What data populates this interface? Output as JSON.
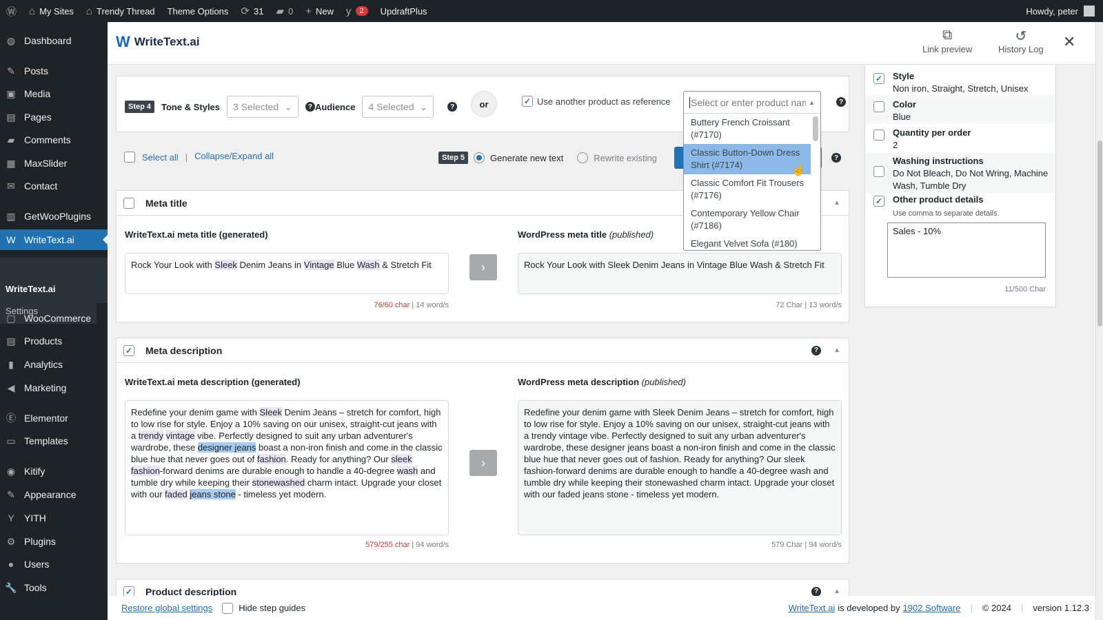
{
  "adminbar": {
    "items": [
      {
        "icon": "wordpress-icon",
        "label": ""
      },
      {
        "icon": "my-sites-icon",
        "label": "My Sites"
      },
      {
        "icon": "home-icon",
        "label": "Trendy Thread"
      },
      {
        "icon": "",
        "label": "Theme Options"
      },
      {
        "icon": "updates-icon",
        "label": "31"
      },
      {
        "icon": "comments-icon",
        "label": "0"
      },
      {
        "icon": "plus-icon",
        "label": "New"
      },
      {
        "icon": "yoast-icon",
        "label": "",
        "badge": "2"
      },
      {
        "icon": "",
        "label": "UpdraftPlus"
      }
    ],
    "howdy": "Howdy, peter"
  },
  "sidebar": {
    "items": [
      "Dashboard",
      "Posts",
      "Media",
      "Pages",
      "Comments",
      "MaxSlider",
      "Contact",
      "GetWooPlugins",
      "WriteText.ai",
      "WooCommerce",
      "Products",
      "Analytics",
      "Marketing",
      "Elementor",
      "Templates",
      "Kitify",
      "Appearance",
      "YITH",
      "Plugins",
      "Users",
      "Tools"
    ],
    "active": "WriteText.ai",
    "submenu": [
      "WriteText.ai",
      "Settings"
    ]
  },
  "header": {
    "brand": "WriteText.ai",
    "link_preview": "Link preview",
    "history_log": "History Log"
  },
  "step4": {
    "badge": "Step 4",
    "tone_label": "Tone & Styles",
    "tone_value": "3 Selected",
    "audience_label": "Audience",
    "audience_value": "4 Selected",
    "or": "or",
    "reference_label": "Use another product as reference",
    "reference_checked": true,
    "product_placeholder": "Select or enter product nam",
    "options": [
      "Buttery French Croissant (#7170)",
      "Classic Button-Down Dress Shirt (#7174)",
      "Classic Comfort Fit Trousers (#7176)",
      "Contemporary Yellow Chair (#7186)",
      "Elegant Velvet Sofa (#180)"
    ],
    "highlighted_option": 1
  },
  "toolbar": {
    "select_all": "Select all",
    "collapse": "Collapse/Expand all",
    "step5": "Step 5",
    "generate": "Generate new text",
    "rewrite": "Rewrite existing",
    "mode": "generate"
  },
  "meta_title": {
    "title": "Meta title",
    "checked": false,
    "gen_label": "WriteText.ai meta title (generated)",
    "pub_label": "WordPress meta title",
    "pub_suffix": "(published)",
    "generated": [
      {
        "t": "Rock Your Look with "
      },
      {
        "t": "Sleek",
        "h": "kw"
      },
      {
        "t": " Denim Jeans in "
      },
      {
        "t": "Vintage",
        "h": "kw"
      },
      {
        "t": " Blue "
      },
      {
        "t": "Wash",
        "h": "kw"
      },
      {
        "t": " & Stretch Fit"
      }
    ],
    "gen_chars": "76/60 char",
    "gen_words": "| 14 word/s",
    "published": "Rock Your Look with Sleek Denim Jeans in Vintage Blue Wash & Stretch Fit",
    "pub_count": "72 Char | 13 word/s"
  },
  "meta_description": {
    "title": "Meta description",
    "checked": true,
    "gen_label": "WriteText.ai meta description (generated)",
    "pub_label": "WordPress meta description",
    "pub_suffix": "(published)",
    "generated": [
      {
        "t": "Redefine your denim game with "
      },
      {
        "t": "Sleek",
        "h": "kw"
      },
      {
        "t": " Denim Jeans – stretch for comfort, high to low rise for style. Enjoy a 10% saving on our unisex, straight-cut jeans with a "
      },
      {
        "t": "trendy",
        "h": "kw"
      },
      {
        "t": " "
      },
      {
        "t": "vintage",
        "h": "kw"
      },
      {
        "t": " vibe. Perfectly designed to suit any urban adventurer's wardrobe, these "
      },
      {
        "t": "designer jeans",
        "h": "hl"
      },
      {
        "t": " boast a non-iron finish and come in the classic blue hue that never goes out of "
      },
      {
        "t": "fashion",
        "h": "kw"
      },
      {
        "t": ". Ready for anything? Our "
      },
      {
        "t": "sleek",
        "h": "kw"
      },
      {
        "t": " "
      },
      {
        "t": "fashion",
        "h": "kw"
      },
      {
        "t": "-forward denims are durable enough to handle a 40-degree "
      },
      {
        "t": "wash",
        "h": "kw"
      },
      {
        "t": " and tumble dry while keeping their "
      },
      {
        "t": "stonewashed",
        "h": "kw"
      },
      {
        "t": " charm intact. Upgrade your closet with our "
      },
      {
        "t": "faded",
        "h": "kw"
      },
      {
        "t": " "
      },
      {
        "t": "jeans stone",
        "h": "hl"
      },
      {
        "t": " - timeless yet modern."
      }
    ],
    "gen_chars": "579/255 char",
    "gen_words": "| 94 word/s",
    "published": "Redefine your denim game with Sleek Denim Jeans – stretch for comfort, high to low rise for style. Enjoy a 10% saving on our unisex, straight-cut jeans with a trendy vintage vibe. Perfectly designed to suit any urban adventurer's wardrobe, these designer jeans boast a non-iron finish and come in the classic blue hue that never goes out of fashion. Ready for anything? Our sleek fashion-forward denims are durable enough to handle a 40-degree wash and tumble dry while keeping their stonewashed charm intact. Upgrade your closet with our faded jeans stone - timeless yet modern.",
    "pub_count": "579 Char | 94 word/s"
  },
  "product_description": {
    "title": "Product description",
    "checked": true
  },
  "attributes": [
    {
      "name": "Style",
      "value": "Non iron, Straight, Stretch, Unisex",
      "checked": true
    },
    {
      "name": "Color",
      "value": "Blue",
      "checked": false
    },
    {
      "name": "Quantity per order",
      "value": "2",
      "checked": false
    },
    {
      "name": "Washing instructions",
      "value": "Do Not Bleach, Do Not Wring, Machine Wash, Tumble Dry",
      "checked": false
    }
  ],
  "other_details": {
    "label": "Other product details",
    "checked": true,
    "hint": "Use comma to separate details.",
    "value": "Sales - 10%",
    "count": "11/500 Char"
  },
  "footer": {
    "restore": "Restore global settings",
    "hide_guides": "Hide step guides",
    "brand_link": "WriteText.ai",
    "developed_by": "is developed by",
    "company": "1902 Software",
    "copyright": "© 2024",
    "version": "version 1.12.3"
  },
  "colors": {
    "accent": "#2271b1",
    "adminbar": "#1d2327",
    "error": "#d63638"
  }
}
